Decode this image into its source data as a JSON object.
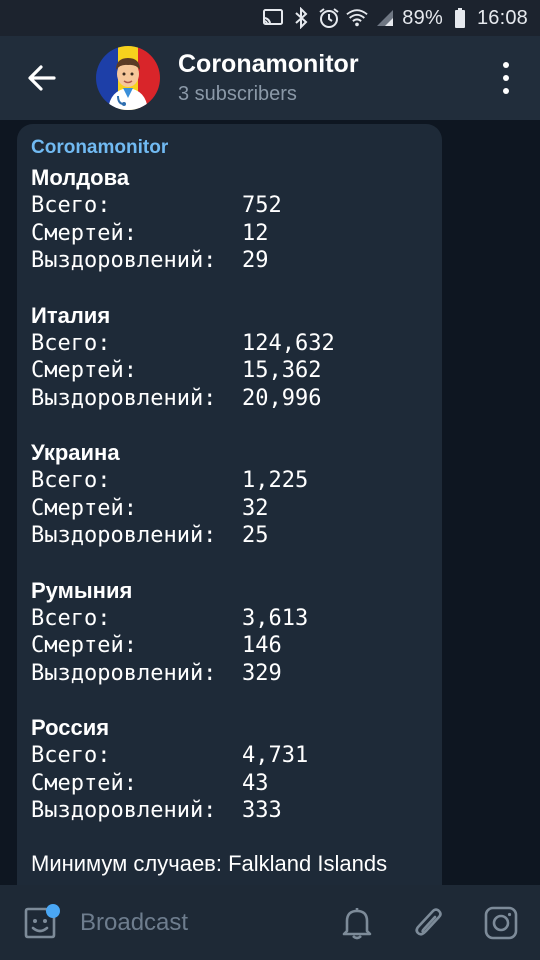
{
  "status_bar": {
    "battery_percent": "89%",
    "time": "16:08",
    "icons": [
      "cast-icon",
      "bluetooth-icon",
      "alarm-icon",
      "wifi-icon",
      "signal-icon",
      "battery-icon"
    ]
  },
  "header": {
    "title": "Coronamonitor",
    "subtitle": "3 subscribers",
    "back_icon": "back-arrow-icon",
    "menu_icon": "more-vertical-icon"
  },
  "message": {
    "sender": "Coronamonitor",
    "countries": [
      {
        "name": "Молдова",
        "total_label": "Всего:",
        "total": "752",
        "deaths_label": "Смертей:",
        "deaths": "12",
        "recovered_label": "Выздоровлений:",
        "recovered": "29"
      },
      {
        "name": "Италия",
        "total_label": "Всего:",
        "total": "124,632",
        "deaths_label": "Смертей:",
        "deaths": "15,362",
        "recovered_label": "Выздоровлений:",
        "recovered": "20,996"
      },
      {
        "name": "Украина",
        "total_label": "Всего:",
        "total": "1,225",
        "deaths_label": "Смертей:",
        "deaths": "32",
        "recovered_label": "Выздоровлений:",
        "recovered": "25"
      },
      {
        "name": "Румыния",
        "total_label": "Всего:",
        "total": "3,613",
        "deaths_label": "Смертей:",
        "deaths": "146",
        "recovered_label": "Выздоровлений:",
        "recovered": "329"
      },
      {
        "name": "Россия",
        "total_label": "Всего:",
        "total": "4,731",
        "deaths_label": "Смертей:",
        "deaths": "43",
        "recovered_label": "Выздоровлений:",
        "recovered": "333"
      }
    ],
    "summary": "Минимум случаев: Falkland Islands"
  },
  "bottom_bar": {
    "placeholder": "Broadcast",
    "icons": [
      "sticker-icon",
      "bell-icon",
      "attach-icon",
      "camera-icon"
    ]
  },
  "colors": {
    "header_bg": "#212d3b",
    "chat_bg": "#0e1621",
    "bubble_bg": "#1e2a38",
    "accent": "#71baf2",
    "notify_dot": "#4aa7f5"
  }
}
